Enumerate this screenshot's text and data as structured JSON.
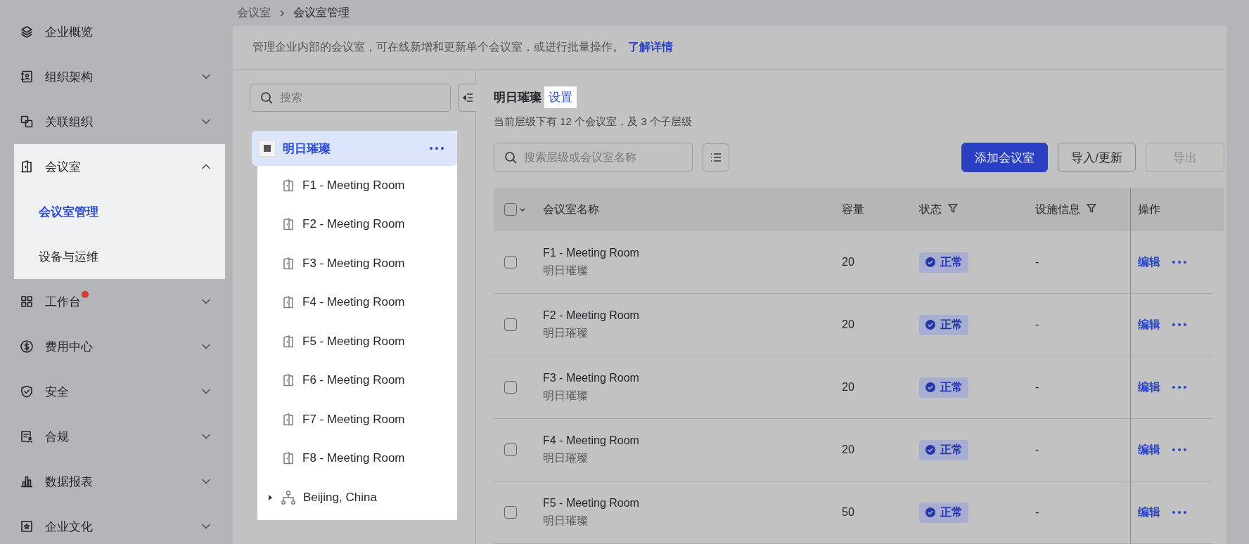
{
  "sidebar": {
    "items": [
      {
        "label": "企业概览",
        "notification": false,
        "highlighted": false
      },
      {
        "label": "组织架构",
        "expanded": false,
        "notification": false,
        "highlighted": false
      },
      {
        "label": "关联组织",
        "expanded": false,
        "notification": false,
        "highlighted": false
      },
      {
        "label": "会议室",
        "expanded": true,
        "notification": false,
        "highlighted": true,
        "children": [
          {
            "label": "会议室管理",
            "selected": true
          },
          {
            "label": "设备与运维",
            "selected": false
          }
        ]
      },
      {
        "label": "工作台",
        "expanded": false,
        "notification": true,
        "highlighted": false
      },
      {
        "label": "费用中心",
        "expanded": false,
        "notification": false,
        "highlighted": false
      },
      {
        "label": "安全",
        "expanded": false,
        "notification": false,
        "highlighted": false
      },
      {
        "label": "合规",
        "expanded": false,
        "notification": false,
        "highlighted": false
      },
      {
        "label": "数据报表",
        "expanded": false,
        "notification": false,
        "highlighted": false
      },
      {
        "label": "企业文化",
        "expanded": false,
        "notification": false,
        "highlighted": false
      }
    ]
  },
  "breadcrumb": [
    "会议室",
    "会议室管理"
  ],
  "description": {
    "text": "管理企业内部的会议室，可在线新增和更新单个会议室，或进行批量操作。",
    "link": "了解详情"
  },
  "tree": {
    "search": {
      "placeholder": "搜索"
    },
    "highlighted": true,
    "root": {
      "label": "明日璀璨",
      "selected": true,
      "children": [
        {
          "label": "F1 - Meeting Room",
          "kind": "room"
        },
        {
          "label": "F2 - Meeting Room",
          "kind": "room"
        },
        {
          "label": "F3 - Meeting Room",
          "kind": "room"
        },
        {
          "label": "F4 - Meeting Room",
          "kind": "room"
        },
        {
          "label": "F5 - Meeting Room",
          "kind": "room"
        },
        {
          "label": "F6 - Meeting Room",
          "kind": "room"
        },
        {
          "label": "F7 - Meeting Room",
          "kind": "room"
        },
        {
          "label": "F8 - Meeting Room",
          "kind": "room"
        },
        {
          "label": "Beijing, China",
          "kind": "group",
          "expanded": false
        }
      ]
    }
  },
  "detail": {
    "title": "明日璀璨",
    "settings_link": {
      "label": "设置",
      "highlighted": true
    },
    "summary": "当前层级下有 12 个会议室，及 3 个子层级",
    "search": {
      "placeholder": "搜索层级或会议室名称"
    },
    "buttons": [
      {
        "label": "添加会议室",
        "kind": "primary",
        "disabled": false
      },
      {
        "label": "导入/更新",
        "kind": "default",
        "disabled": false
      },
      {
        "label": "导出",
        "kind": "default",
        "disabled": true
      }
    ],
    "table": {
      "select_all_checked": false,
      "columns": [
        {
          "label": "会议室名称",
          "filter": false
        },
        {
          "label": "容量",
          "filter": false
        },
        {
          "label": "状态",
          "filter": true
        },
        {
          "label": "设施信息",
          "filter": true
        },
        {
          "label": "操作",
          "filter": false
        }
      ],
      "rows": [
        {
          "checked": false,
          "name": "F1 - Meeting Room",
          "group": "明日璀璨",
          "capacity": "20",
          "status": "正常",
          "facilities": "-",
          "action": "编辑"
        },
        {
          "checked": false,
          "name": "F2 - Meeting Room",
          "group": "明日璀璨",
          "capacity": "20",
          "status": "正常",
          "facilities": "-",
          "action": "编辑"
        },
        {
          "checked": false,
          "name": "F3 - Meeting Room",
          "group": "明日璀璨",
          "capacity": "20",
          "status": "正常",
          "facilities": "-",
          "action": "编辑"
        },
        {
          "checked": false,
          "name": "F4 - Meeting Room",
          "group": "明日璀璨",
          "capacity": "20",
          "status": "正常",
          "facilities": "-",
          "action": "编辑"
        },
        {
          "checked": false,
          "name": "F5 - Meeting Room",
          "group": "明日璀璨",
          "capacity": "50",
          "status": "正常",
          "facilities": "-",
          "action": "编辑"
        }
      ]
    }
  }
}
